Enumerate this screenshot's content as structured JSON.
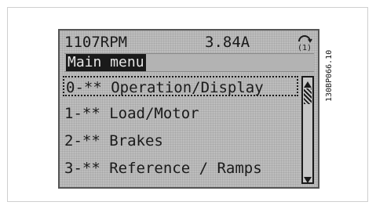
{
  "status": {
    "rpm": "1107RPM",
    "current": "3.84A",
    "icon": "hand-auto-icon",
    "icon_label": "(1)"
  },
  "menu": {
    "title": "Main menu",
    "items": [
      {
        "label": "0-** Operation/Display",
        "selected": true
      },
      {
        "label": "1-** Load/Motor",
        "selected": false
      },
      {
        "label": "2-** Brakes",
        "selected": false
      },
      {
        "label": "3-** Reference / Ramps",
        "selected": false
      }
    ]
  },
  "ref_code": "130BP066.10",
  "colors": {
    "lcd_bg": "#bdbdbd",
    "text": "#1a1a1a",
    "header_bg": "#1a1a1a",
    "header_text": "#e6e6e6"
  }
}
